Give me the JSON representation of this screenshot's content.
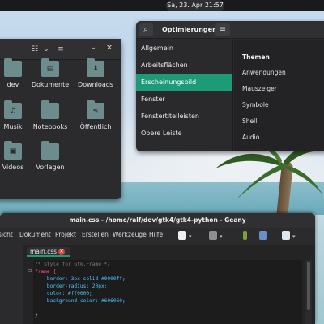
{
  "topbar": {
    "clock": "Sa, 23. Apr  21:57"
  },
  "files": {
    "items": [
      {
        "label": "dev",
        "icon": "folder-icon",
        "glyph": ""
      },
      {
        "label": "Dokumente",
        "icon": "documents-folder-icon",
        "glyph": "▤"
      },
      {
        "label": "Downloads",
        "icon": "downloads-folder-icon",
        "glyph": "⬇"
      },
      {
        "label": "Musik",
        "icon": "music-folder-icon",
        "glyph": "♫"
      },
      {
        "label": "Notebooks",
        "icon": "folder-icon",
        "glyph": ""
      },
      {
        "label": "Öffentlich",
        "icon": "public-share-folder-icon",
        "glyph": "⋖"
      },
      {
        "label": "Videos",
        "icon": "videos-folder-icon",
        "glyph": "▣"
      },
      {
        "label": "Vorlagen",
        "icon": "templates-folder-icon",
        "glyph": ""
      }
    ],
    "header_icons": [
      "view-list-icon",
      "chevron-down-icon",
      "menu-icon",
      "minimize-icon",
      "close-icon"
    ]
  },
  "tweaks": {
    "title": "Optimierungen",
    "sidebar": [
      "Allgemein",
      "Arbeitsflächen",
      "Erscheinungsbild",
      "Fenster",
      "Fenstertitelleisten",
      "Obere Leiste"
    ],
    "active_index": 2,
    "section_title": "Themen",
    "panel_items": [
      "Anwendungen",
      "Mauszeiger",
      "Symbole",
      "Shell",
      "Audio"
    ],
    "accent": "#1d9a78"
  },
  "geany": {
    "title": "main.css - /home/ralf/dev/gtk4/gtk4-python - Geany",
    "menu": [
      "sicht",
      "Dokument",
      "Projekt",
      "Erstellen",
      "Werkzeuge",
      "Hilfe"
    ],
    "tab": "main.css",
    "code": [
      "/* Style for Gtk.Frame */",
      "frame {",
      "    border: 3px solid #0000ff;",
      "    border-radius: 20px;",
      "    color: #ff0000;",
      "    background-color: #606060;",
      "",
      "}"
    ]
  }
}
